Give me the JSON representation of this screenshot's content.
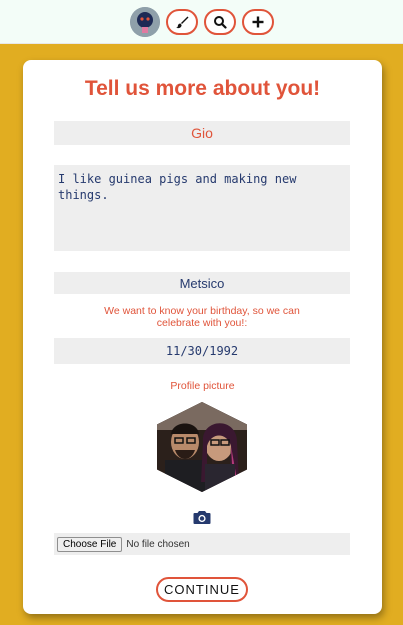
{
  "nav": {
    "avatar_icon": "user-avatar",
    "buttons": [
      {
        "icon": "brush-icon"
      },
      {
        "icon": "search-icon"
      },
      {
        "icon": "plus-icon"
      }
    ]
  },
  "form": {
    "title": "Tell us more about you!",
    "name_value": "Gio",
    "bio_value": "I like guinea pigs and making new things.",
    "location_value": "Metsico",
    "birthday_label": "We want to know your birthday, so we can celebrate with you!:",
    "birthday_value": "11/30/1992",
    "picture_label": "Profile picture",
    "file_button_label": "Choose File",
    "file_status": "No file chosen",
    "continue_label": "CONTINUE"
  },
  "colors": {
    "accent": "#e0543a",
    "navy": "#263a6e",
    "background": "#e1ad21",
    "nav_bg": "#f3fdf8"
  }
}
